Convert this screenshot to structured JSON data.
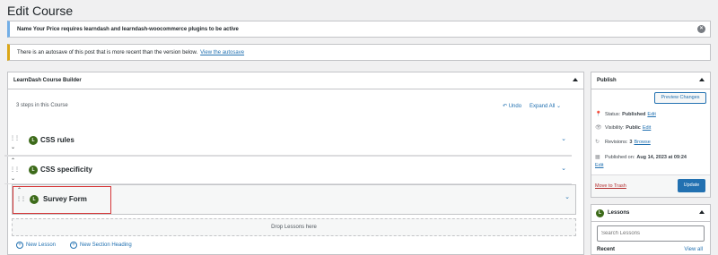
{
  "page": {
    "title": "Edit Course"
  },
  "notices": {
    "plugin": "Name Your Price requires learndash and learndash-woocommerce plugins to be active",
    "autosave_text": "There is an autosave of this post that is more recent than the version below.",
    "autosave_link": "View the autosave"
  },
  "builder": {
    "title": "LearnDash Course Builder",
    "steps": "3 steps in this Course",
    "undo": "Undo",
    "expand": "Expand All",
    "lessons": [
      {
        "badge": "L",
        "title": "CSS rules"
      },
      {
        "badge": "L",
        "title": "CSS specificity"
      },
      {
        "badge": "L",
        "title": "Survey Form"
      }
    ],
    "drop": "Drop Lessons here",
    "new_lesson": "New Lesson",
    "new_section": "New Section Heading"
  },
  "publish": {
    "title": "Publish",
    "preview": "Preview Changes",
    "status_label": "Status:",
    "status_value": "Published",
    "visibility_label": "Visibility:",
    "visibility_value": "Public",
    "revisions_label": "Revisions:",
    "revisions_value": "3",
    "browse": "Browse",
    "published_label": "Published on:",
    "published_value": "Aug 14, 2023 at 09:24",
    "edit": "Edit",
    "trash": "Move to Trash",
    "update": "Update"
  },
  "lessons_box": {
    "badge": "L",
    "title": "Lessons",
    "search_placeholder": "Search Lessons",
    "recent": "Recent",
    "view_all": "View all"
  }
}
